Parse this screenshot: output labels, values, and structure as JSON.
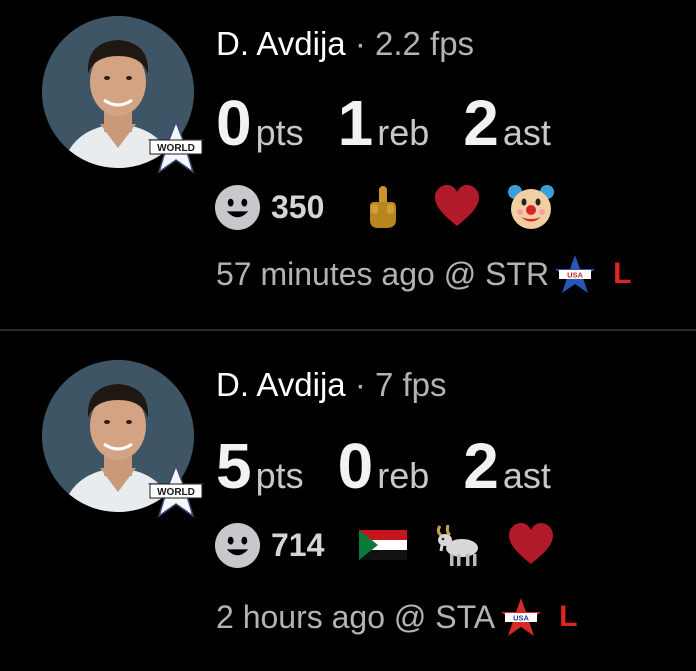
{
  "games": [
    {
      "player": "D. Avdija",
      "separator": "·",
      "fps": "2.2 fps",
      "stats": [
        {
          "value": "0",
          "unit": "pts"
        },
        {
          "value": "1",
          "unit": "reb"
        },
        {
          "value": "2",
          "unit": "ast"
        }
      ],
      "reaction_count": "350",
      "reaction_icons": [
        "middle-finger-emoji",
        "red-heart-emoji",
        "clown-face-emoji"
      ],
      "time_ago": "57 minutes ago @ STR",
      "team_logo": "usa-star-logo-blue",
      "result": "L",
      "badge_text": "WORLD"
    },
    {
      "player": "D. Avdija",
      "separator": "·",
      "fps": "7 fps",
      "stats": [
        {
          "value": "5",
          "unit": "pts"
        },
        {
          "value": "0",
          "unit": "reb"
        },
        {
          "value": "2",
          "unit": "ast"
        }
      ],
      "reaction_count": "714",
      "reaction_icons": [
        "sudan-flag-emoji",
        "goat-emoji",
        "red-heart-emoji"
      ],
      "time_ago": "2 hours ago @ STA",
      "team_logo": "usa-star-logo-red",
      "result": "L",
      "badge_text": "WORLD"
    }
  ],
  "colors": {
    "background": "#000000",
    "divider": "#2a2a2a",
    "result_loss": "#e02424",
    "avatar_bg": "#3e5566"
  }
}
